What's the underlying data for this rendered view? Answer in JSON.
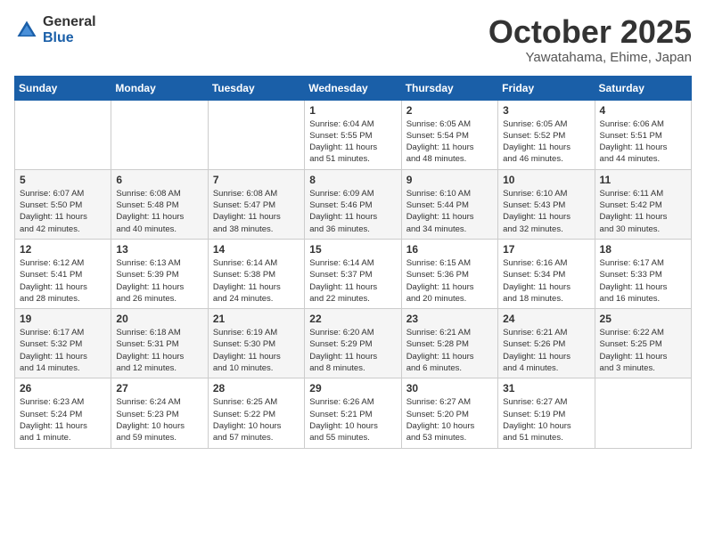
{
  "header": {
    "logo_general": "General",
    "logo_blue": "Blue",
    "month_title": "October 2025",
    "subtitle": "Yawatahama, Ehime, Japan"
  },
  "weekdays": [
    "Sunday",
    "Monday",
    "Tuesday",
    "Wednesday",
    "Thursday",
    "Friday",
    "Saturday"
  ],
  "weeks": [
    [
      {
        "day": "",
        "info": ""
      },
      {
        "day": "",
        "info": ""
      },
      {
        "day": "",
        "info": ""
      },
      {
        "day": "1",
        "info": "Sunrise: 6:04 AM\nSunset: 5:55 PM\nDaylight: 11 hours\nand 51 minutes."
      },
      {
        "day": "2",
        "info": "Sunrise: 6:05 AM\nSunset: 5:54 PM\nDaylight: 11 hours\nand 48 minutes."
      },
      {
        "day": "3",
        "info": "Sunrise: 6:05 AM\nSunset: 5:52 PM\nDaylight: 11 hours\nand 46 minutes."
      },
      {
        "day": "4",
        "info": "Sunrise: 6:06 AM\nSunset: 5:51 PM\nDaylight: 11 hours\nand 44 minutes."
      }
    ],
    [
      {
        "day": "5",
        "info": "Sunrise: 6:07 AM\nSunset: 5:50 PM\nDaylight: 11 hours\nand 42 minutes."
      },
      {
        "day": "6",
        "info": "Sunrise: 6:08 AM\nSunset: 5:48 PM\nDaylight: 11 hours\nand 40 minutes."
      },
      {
        "day": "7",
        "info": "Sunrise: 6:08 AM\nSunset: 5:47 PM\nDaylight: 11 hours\nand 38 minutes."
      },
      {
        "day": "8",
        "info": "Sunrise: 6:09 AM\nSunset: 5:46 PM\nDaylight: 11 hours\nand 36 minutes."
      },
      {
        "day": "9",
        "info": "Sunrise: 6:10 AM\nSunset: 5:44 PM\nDaylight: 11 hours\nand 34 minutes."
      },
      {
        "day": "10",
        "info": "Sunrise: 6:10 AM\nSunset: 5:43 PM\nDaylight: 11 hours\nand 32 minutes."
      },
      {
        "day": "11",
        "info": "Sunrise: 6:11 AM\nSunset: 5:42 PM\nDaylight: 11 hours\nand 30 minutes."
      }
    ],
    [
      {
        "day": "12",
        "info": "Sunrise: 6:12 AM\nSunset: 5:41 PM\nDaylight: 11 hours\nand 28 minutes."
      },
      {
        "day": "13",
        "info": "Sunrise: 6:13 AM\nSunset: 5:39 PM\nDaylight: 11 hours\nand 26 minutes."
      },
      {
        "day": "14",
        "info": "Sunrise: 6:14 AM\nSunset: 5:38 PM\nDaylight: 11 hours\nand 24 minutes."
      },
      {
        "day": "15",
        "info": "Sunrise: 6:14 AM\nSunset: 5:37 PM\nDaylight: 11 hours\nand 22 minutes."
      },
      {
        "day": "16",
        "info": "Sunrise: 6:15 AM\nSunset: 5:36 PM\nDaylight: 11 hours\nand 20 minutes."
      },
      {
        "day": "17",
        "info": "Sunrise: 6:16 AM\nSunset: 5:34 PM\nDaylight: 11 hours\nand 18 minutes."
      },
      {
        "day": "18",
        "info": "Sunrise: 6:17 AM\nSunset: 5:33 PM\nDaylight: 11 hours\nand 16 minutes."
      }
    ],
    [
      {
        "day": "19",
        "info": "Sunrise: 6:17 AM\nSunset: 5:32 PM\nDaylight: 11 hours\nand 14 minutes."
      },
      {
        "day": "20",
        "info": "Sunrise: 6:18 AM\nSunset: 5:31 PM\nDaylight: 11 hours\nand 12 minutes."
      },
      {
        "day": "21",
        "info": "Sunrise: 6:19 AM\nSunset: 5:30 PM\nDaylight: 11 hours\nand 10 minutes."
      },
      {
        "day": "22",
        "info": "Sunrise: 6:20 AM\nSunset: 5:29 PM\nDaylight: 11 hours\nand 8 minutes."
      },
      {
        "day": "23",
        "info": "Sunrise: 6:21 AM\nSunset: 5:28 PM\nDaylight: 11 hours\nand 6 minutes."
      },
      {
        "day": "24",
        "info": "Sunrise: 6:21 AM\nSunset: 5:26 PM\nDaylight: 11 hours\nand 4 minutes."
      },
      {
        "day": "25",
        "info": "Sunrise: 6:22 AM\nSunset: 5:25 PM\nDaylight: 11 hours\nand 3 minutes."
      }
    ],
    [
      {
        "day": "26",
        "info": "Sunrise: 6:23 AM\nSunset: 5:24 PM\nDaylight: 11 hours\nand 1 minute."
      },
      {
        "day": "27",
        "info": "Sunrise: 6:24 AM\nSunset: 5:23 PM\nDaylight: 10 hours\nand 59 minutes."
      },
      {
        "day": "28",
        "info": "Sunrise: 6:25 AM\nSunset: 5:22 PM\nDaylight: 10 hours\nand 57 minutes."
      },
      {
        "day": "29",
        "info": "Sunrise: 6:26 AM\nSunset: 5:21 PM\nDaylight: 10 hours\nand 55 minutes."
      },
      {
        "day": "30",
        "info": "Sunrise: 6:27 AM\nSunset: 5:20 PM\nDaylight: 10 hours\nand 53 minutes."
      },
      {
        "day": "31",
        "info": "Sunrise: 6:27 AM\nSunset: 5:19 PM\nDaylight: 10 hours\nand 51 minutes."
      },
      {
        "day": "",
        "info": ""
      }
    ]
  ]
}
